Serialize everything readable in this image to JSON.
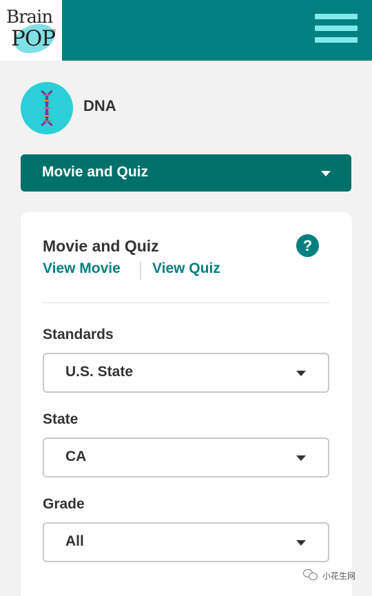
{
  "header": {
    "logo_line1": "Brain",
    "logo_line2": "POP",
    "logo_mark": "®",
    "menu_icon": "hamburger-menu-icon",
    "colors": {
      "bar": "#008080",
      "menu": "#7fe9ed"
    }
  },
  "topic": {
    "title": "DNA",
    "icon": "dna-helix-icon"
  },
  "mode_select": {
    "selected": "Movie and Quiz",
    "icon": "chevron-down-icon"
  },
  "card": {
    "title": "Movie and Quiz",
    "help_icon": "?",
    "links": {
      "movie": "View Movie",
      "quiz": "View Quiz"
    },
    "fields": [
      {
        "label": "Standards",
        "value": "U.S. State"
      },
      {
        "label": "State",
        "value": "CA"
      },
      {
        "label": "Grade",
        "value": "All"
      }
    ]
  },
  "watermark": {
    "text": "小花生网"
  }
}
